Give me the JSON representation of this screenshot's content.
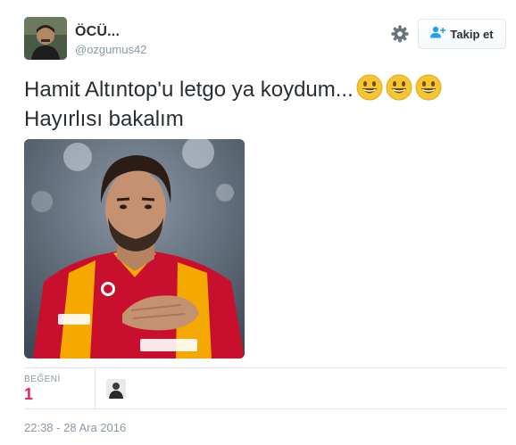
{
  "user": {
    "display_name": "ÖCÜ...",
    "screen_name": "@ozgumus42",
    "avatar_icon": "user-avatar"
  },
  "actions": {
    "settings_icon": "gear-icon",
    "follow_label": "Takip et",
    "follow_icon": "add-user-icon"
  },
  "tweet": {
    "line1": "Hamit Altıntop'u letgo ya koydum...",
    "line2": "Hayırlısı bakalım",
    "emoji": [
      "grinning-face-emoji",
      "grinning-face-emoji",
      "grinning-face-emoji"
    ]
  },
  "stats": {
    "likes_label": "BEĞENİ",
    "likes_count": "1"
  },
  "timestamp": "22:38 - 28 Ara 2016",
  "colors": {
    "text": "#292f33",
    "muted": "#8899a6",
    "like": "#e0245e",
    "divider": "#e1e8ed",
    "jersey_red": "#c8102e",
    "jersey_yellow": "#f5a800"
  }
}
